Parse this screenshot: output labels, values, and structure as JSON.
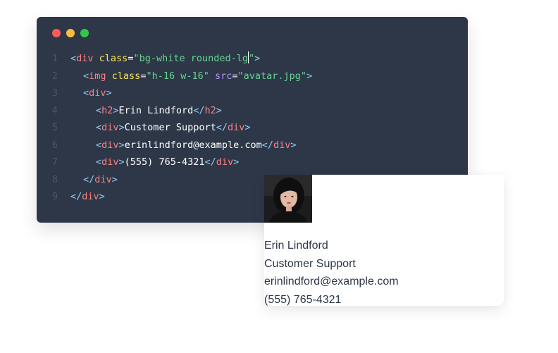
{
  "editor": {
    "line_numbers": [
      "1",
      "2",
      "3",
      "4",
      "5",
      "6",
      "7",
      "8",
      "9"
    ],
    "line1": {
      "open": "<",
      "tag": "div",
      "attr": "class",
      "eq": "=",
      "value_pre": "\"bg-white rounded-lg",
      "value_post": "\"",
      "close": ">"
    },
    "line2": {
      "open": "<",
      "tag": "img",
      "attr1": "class",
      "eq1": "=",
      "val1": "\"h-16 w-16\"",
      "attr2": "src",
      "eq2": "=",
      "val2": "\"avatar.jpg\"",
      "close": ">"
    },
    "line3": {
      "open": "<",
      "tag": "div",
      "close": ">"
    },
    "line4": {
      "open": "<",
      "tag": "h2",
      "close": ">",
      "text": "Erin Lindford",
      "end_open": "</",
      "end_tag": "h2",
      "end_close": ">"
    },
    "line5": {
      "open": "<",
      "tag": "div",
      "close": ">",
      "text": "Customer Support",
      "end_open": "</",
      "end_tag": "div",
      "end_close": ">"
    },
    "line6": {
      "open": "<",
      "tag": "div",
      "close": ">",
      "text": "erinlindford@example.com",
      "end_open": "</",
      "end_tag": "div",
      "end_close": ">"
    },
    "line7": {
      "open": "<",
      "tag": "div",
      "close": ">",
      "text": "(555) 765-4321",
      "end_open": "</",
      "end_tag": "div",
      "end_close": ">"
    },
    "line8": {
      "open": "</",
      "tag": "div",
      "close": ">"
    },
    "line9": {
      "open": "</",
      "tag": "div",
      "close": ">"
    }
  },
  "card": {
    "name": "Erin Lindford",
    "role": "Customer Support",
    "email": "erinlindford@example.com",
    "phone": "(555) 765-4321"
  },
  "colors": {
    "editor_bg": "#2d3748",
    "tag": "#fc8181",
    "attribute": "#f6e05e",
    "string": "#68d391",
    "bracket": "#90cdf4",
    "line_number": "#4a5568"
  },
  "icons": [
    "close-dot",
    "minimize-dot",
    "maximize-dot"
  ]
}
